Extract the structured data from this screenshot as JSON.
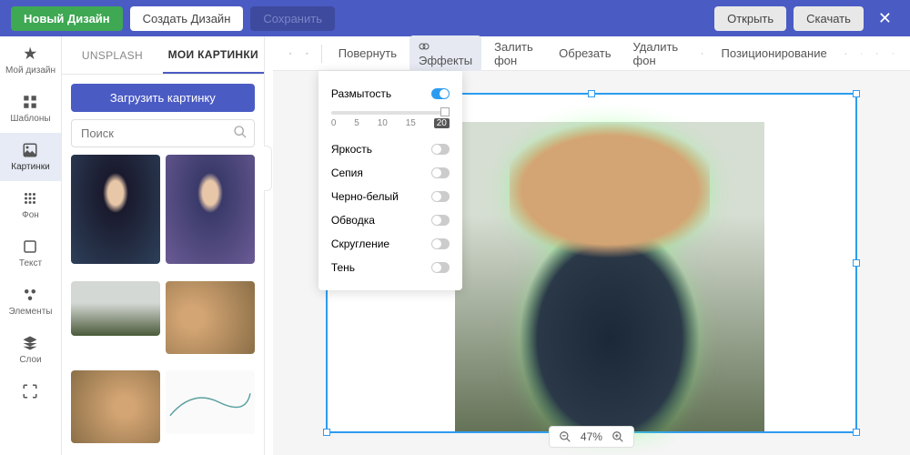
{
  "topbar": {
    "new_design": "Новый Дизайн",
    "create_design": "Создать Дизайн",
    "save": "Сохранить",
    "open": "Открыть",
    "download": "Скачать"
  },
  "leftnav": {
    "my_design": "Мой дизайн",
    "templates": "Шаблоны",
    "images": "Картинки",
    "background": "Фон",
    "text": "Текст",
    "elements": "Элементы",
    "layers": "Слои"
  },
  "tabs": {
    "unsplash": "UNSPLASH",
    "my_images": "МОИ КАРТИНКИ"
  },
  "upload_label": "Загрузить картинку",
  "search_placeholder": "Поиск",
  "toolbar": {
    "rotate": "Повернуть",
    "effects": "Эффекты",
    "fill_bg": "Залить фон",
    "crop": "Обрезать",
    "remove_bg": "Удалить фон",
    "positioning": "Позиционирование"
  },
  "effects": {
    "blur": "Размытость",
    "brightness": "Яркость",
    "sepia": "Сепия",
    "bw": "Черно-белый",
    "stroke": "Обводка",
    "rounding": "Скругление",
    "shadow": "Тень",
    "slider_ticks": [
      "0",
      "5",
      "10",
      "15",
      "20"
    ],
    "blur_value": 20,
    "blur_on": true
  },
  "zoom": "47%"
}
